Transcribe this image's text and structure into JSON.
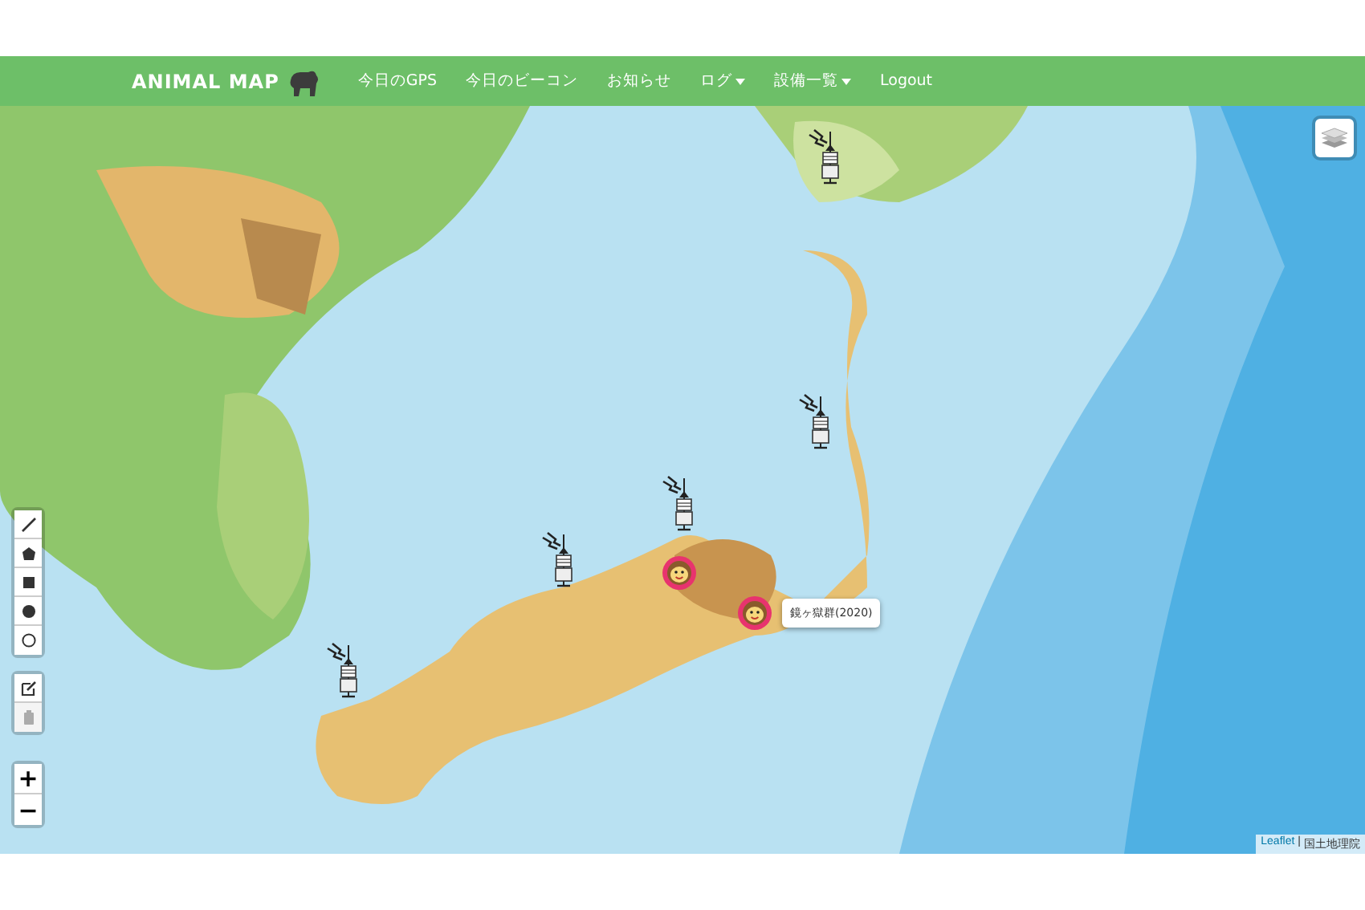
{
  "navbar": {
    "brand": "ANIMAL MAP",
    "items": [
      {
        "label": "今日のGPS",
        "dropdown": false
      },
      {
        "label": "今日のビーコン",
        "dropdown": false
      },
      {
        "label": "お知らせ",
        "dropdown": false
      },
      {
        "label": "ログ",
        "dropdown": true
      },
      {
        "label": "設備一覧",
        "dropdown": true
      },
      {
        "label": "Logout",
        "dropdown": false
      }
    ]
  },
  "map": {
    "draw_tools": [
      {
        "kind": "polyline"
      },
      {
        "kind": "polygon"
      },
      {
        "kind": "rectangle"
      },
      {
        "kind": "circle"
      },
      {
        "kind": "circlemarker"
      }
    ],
    "edit_tools": [
      {
        "kind": "edit",
        "disabled": false
      },
      {
        "kind": "delete",
        "disabled": true
      }
    ],
    "zoom": [
      "+",
      "−"
    ],
    "markers": [
      {
        "kind": "antenna"
      },
      {
        "kind": "antenna"
      },
      {
        "kind": "antenna"
      },
      {
        "kind": "antenna"
      },
      {
        "kind": "antenna"
      },
      {
        "kind": "animal"
      },
      {
        "kind": "animal",
        "tooltip": "鏡ヶ獄群(2020)"
      }
    ],
    "attribution": {
      "link": "Leaflet",
      "separator": "|",
      "source": "国土地理院"
    }
  }
}
